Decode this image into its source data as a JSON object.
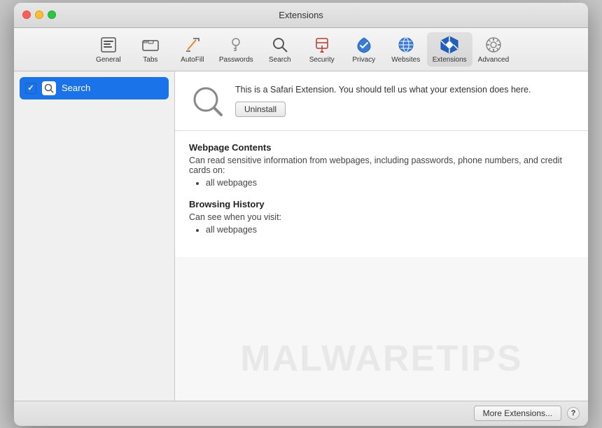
{
  "window": {
    "title": "Extensions"
  },
  "titlebar": {
    "title": "Extensions",
    "buttons": {
      "close": "close",
      "minimize": "minimize",
      "maximize": "maximize"
    }
  },
  "toolbar": {
    "items": [
      {
        "id": "general",
        "label": "General",
        "icon": "📄"
      },
      {
        "id": "tabs",
        "label": "Tabs",
        "icon": "🗂"
      },
      {
        "id": "autofill",
        "label": "AutoFill",
        "icon": "✏️"
      },
      {
        "id": "passwords",
        "label": "Passwords",
        "icon": "🔑"
      },
      {
        "id": "search",
        "label": "Search",
        "icon": "🔍"
      },
      {
        "id": "security",
        "label": "Security",
        "icon": "🔒"
      },
      {
        "id": "privacy",
        "label": "Privacy",
        "icon": "🖐"
      },
      {
        "id": "websites",
        "label": "Websites",
        "icon": "🌐"
      },
      {
        "id": "extensions",
        "label": "Extensions",
        "icon": "⚡",
        "active": true
      },
      {
        "id": "advanced",
        "label": "Advanced",
        "icon": "⚙️"
      }
    ]
  },
  "sidebar": {
    "items": [
      {
        "id": "search-ext",
        "checked": true,
        "label": "Search",
        "selected": true
      }
    ]
  },
  "extension": {
    "description": "This is a Safari Extension. You should tell us what your extension does here.",
    "uninstall_label": "Uninstall",
    "permissions": [
      {
        "title": "Webpage Contents",
        "desc": "Can read sensitive information from webpages, including passwords, phone numbers, and credit cards on:",
        "items": [
          "all webpages"
        ]
      },
      {
        "title": "Browsing History",
        "desc": "Can see when you visit:",
        "items": [
          "all webpages"
        ]
      }
    ]
  },
  "footer": {
    "more_extensions_label": "More Extensions...",
    "help_label": "?"
  },
  "watermark": {
    "text": "MALWARETIPS"
  }
}
